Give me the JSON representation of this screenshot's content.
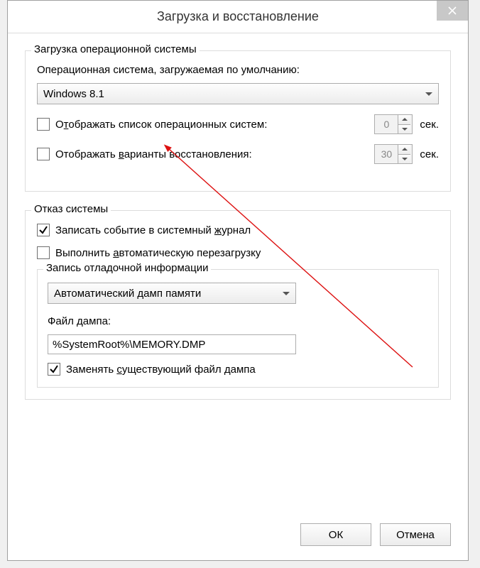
{
  "title": "Загрузка и восстановление",
  "group_boot": {
    "legend": "Загрузка операционной системы",
    "default_os_label": "Операционная система, загружаемая по умолчанию:",
    "default_os_value": "Windows 8.1",
    "show_os_list_prefix": "О",
    "show_os_list_letter": "т",
    "show_os_list_rest": "ображать список операционных систем:",
    "show_os_list_value": "0",
    "show_recovery_prefix": "Отображать ",
    "show_recovery_letter": "в",
    "show_recovery_rest": "арианты восстановления:",
    "show_recovery_value": "30",
    "seconds_label": "сек."
  },
  "group_fail": {
    "legend": "Отказ системы",
    "log_event_prefix": "Записать событие в системный ",
    "log_event_letter": "ж",
    "log_event_rest": "урнал",
    "log_event_checked": true,
    "auto_restart_prefix": "Выполнить ",
    "auto_restart_letter": "а",
    "auto_restart_rest": "втоматическую перезагрузку",
    "auto_restart_checked": false,
    "debug_group_legend": "Запись отладочной информации",
    "dump_type": "Автоматический дамп памяти",
    "dump_file_label": "Файл дампа:",
    "dump_file_value": "%SystemRoot%\\MEMORY.DMP",
    "overwrite_prefix": "Заменять ",
    "overwrite_letter": "с",
    "overwrite_rest": "уществующий файл дампа",
    "overwrite_checked": true
  },
  "buttons": {
    "ok": "ОК",
    "cancel": "Отмена"
  }
}
